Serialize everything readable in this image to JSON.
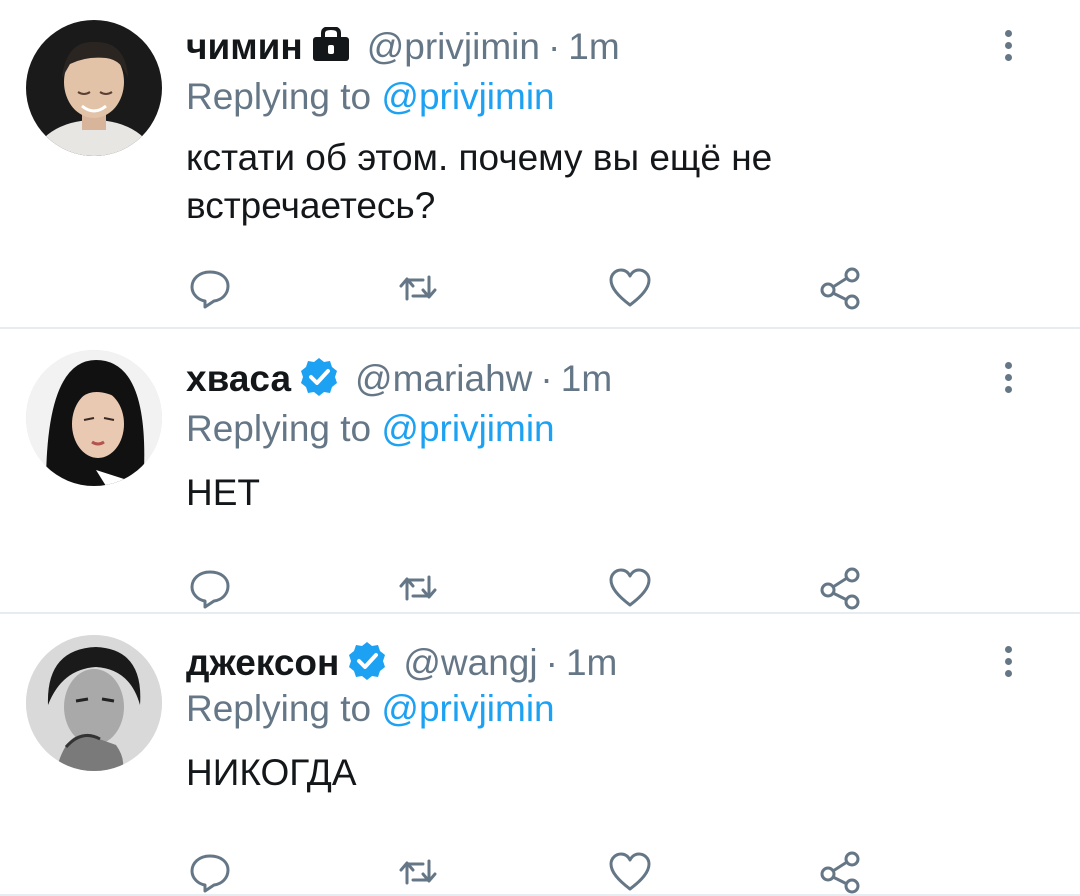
{
  "tweets": [
    {
      "name": "чимин",
      "badge_icon": "lock-icon",
      "handle": "@privjimin",
      "separator": "·",
      "time": "1m",
      "replying_label": "Replying to",
      "replying_to": "@privjimin",
      "text": "кстати об этом. почему вы ещё не встречаетесь?"
    },
    {
      "name": "хваса",
      "badge_icon": "verified-badge-icon",
      "handle": "@mariahw",
      "separator": "·",
      "time": "1m",
      "replying_label": "Replying to",
      "replying_to": "@privjimin",
      "text": "НЕТ"
    },
    {
      "name": "джексон",
      "badge_icon": "verified-badge-icon",
      "handle": "@wangj",
      "separator": "·",
      "time": "1m",
      "replying_label": "Replying to",
      "replying_to": "@privjimin",
      "text": "НИКОГДА"
    }
  ],
  "colors": {
    "text": "#14171a",
    "secondary": "#657786",
    "accent": "#1da1f2",
    "divider": "#e6ecf0"
  },
  "action_icons": [
    "reply-icon",
    "retweet-icon",
    "like-icon",
    "share-icon"
  ]
}
